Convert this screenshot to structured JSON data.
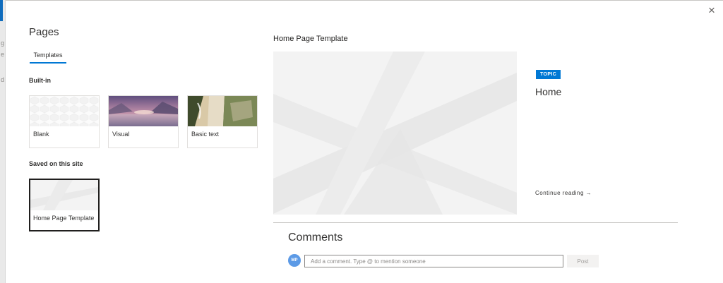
{
  "panel": {
    "title": "Pages",
    "close_icon": "×",
    "tabs": [
      {
        "label": "Templates",
        "selected": true
      }
    ]
  },
  "sections": {
    "built_in_label": "Built-in",
    "saved_label": "Saved on this site"
  },
  "built_in_templates": [
    {
      "name": "Blank",
      "thumbnail": "white-pattern"
    },
    {
      "name": "Visual",
      "thumbnail": "lake-sunset"
    },
    {
      "name": "Basic text",
      "thumbnail": "aerial-beach"
    }
  ],
  "saved_templates": [
    {
      "name": "Home Page Template",
      "selected": true,
      "thumbnail": "grey-geometric"
    }
  ],
  "preview": {
    "title": "Home Page Template",
    "badge": "TOPIC",
    "heading": "Home",
    "continue_reading": "Continue reading",
    "continue_icon": "→"
  },
  "comments": {
    "heading": "Comments",
    "avatar_initials": "MP",
    "input_placeholder": "Add a comment. Type @ to mention someone",
    "post_label": "Post"
  },
  "colors": {
    "accent": "#0078d4",
    "avatar": "#5c9ae6",
    "text": "#323130"
  }
}
